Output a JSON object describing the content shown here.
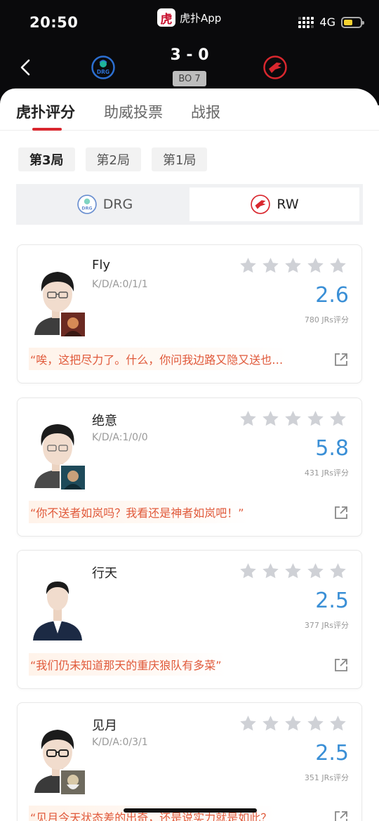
{
  "status_bar": {
    "time": "20:50",
    "network": "4G",
    "app_name": "虎扑App",
    "app_logo_text": "虎"
  },
  "match": {
    "score": "3 - 0",
    "format": "BO 7",
    "team_left": {
      "name": "DRG",
      "logo_text": "DRG",
      "color": "#2c6fd1"
    },
    "team_right": {
      "name": "RW",
      "color": "#d9272e"
    }
  },
  "tabs": [
    {
      "label": "虎扑评分"
    },
    {
      "label": "助威投票"
    },
    {
      "label": "战报"
    }
  ],
  "games": [
    {
      "label": "第3局"
    },
    {
      "label": "第2局"
    },
    {
      "label": "第1局"
    }
  ],
  "team_switch": [
    {
      "label": "DRG"
    },
    {
      "label": "RW"
    }
  ],
  "players": [
    {
      "name": "Fly",
      "kda": "K/D/A:0/1/1",
      "rating": "2.6",
      "votes": "780 JRs评分",
      "quote": "“唉，这把尽力了。什么，你问我边路又隐又送也…"
    },
    {
      "name": "绝意",
      "kda": "K/D/A:1/0/0",
      "rating": "5.8",
      "votes": "431 JRs评分",
      "quote": "“你不送者如岚吗？我看还是神者如岚吧！”"
    },
    {
      "name": "行天",
      "kda": "",
      "rating": "2.5",
      "votes": "377 JRs评分",
      "quote": "“我们仍未知道那天的重庆狼队有多菜”"
    },
    {
      "name": "见月",
      "kda": "K/D/A:0/3/1",
      "rating": "2.5",
      "votes": "351 JRs评分",
      "quote": "“见月今天状态差的出奇，还是说实力就是如此？"
    }
  ],
  "colors": {
    "accent": "#d9272e",
    "rating": "#3a8fd6",
    "quote": "#e0593a"
  }
}
